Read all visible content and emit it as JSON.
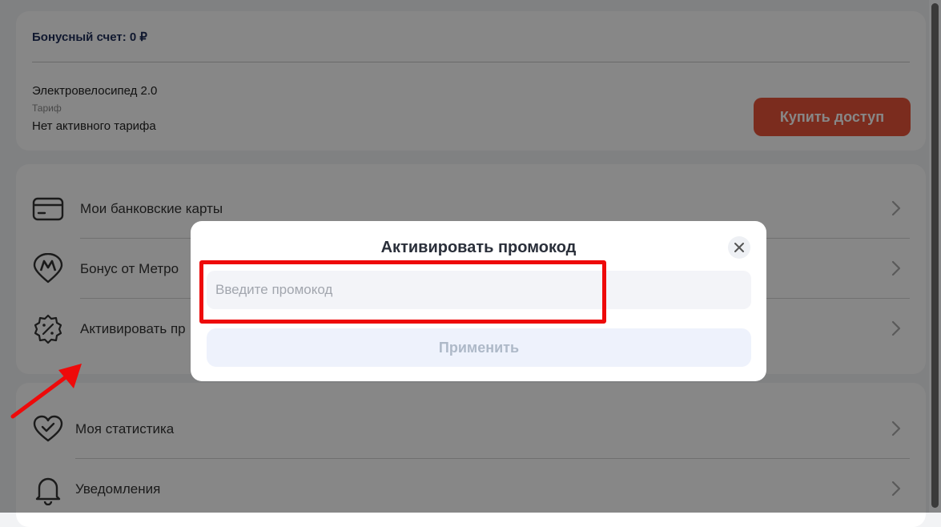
{
  "account": {
    "bonus_label": "Бонусный счет: 0 ₽",
    "product_name": "Электровелосипед 2.0",
    "tariff_label": "Тариф",
    "tariff_value": "Нет активного тарифа",
    "buy_button": "Купить доступ"
  },
  "menu_top": [
    {
      "label": "Мои банковские карты",
      "icon": "credit-card-icon"
    },
    {
      "label": "Бонус от Метро",
      "icon": "metro-pin-icon"
    },
    {
      "label": "Активировать пр",
      "icon": "discount-badge-icon"
    }
  ],
  "menu_bottom": [
    {
      "label": "Моя статистика",
      "icon": "heart-check-icon"
    },
    {
      "label": "Уведомления",
      "icon": "bell-icon"
    }
  ],
  "modal": {
    "title": "Активировать промокод",
    "input_placeholder": "Введите промокод",
    "input_value": "",
    "apply_button": "Применить"
  },
  "colors": {
    "accent": "#e9543a",
    "highlight": "#ee0a0a",
    "bonus_text": "#1f2f5a"
  }
}
